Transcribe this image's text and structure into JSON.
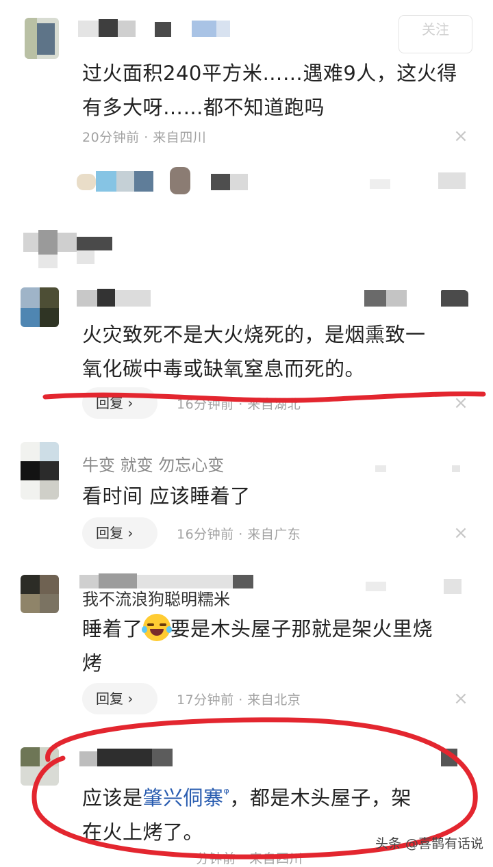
{
  "header": {
    "follow_label": "关注"
  },
  "comments": [
    {
      "text_line1": "过火面积240平方米……遇难9人，这火得",
      "text_line2": "有多大呀……都不知道跑吗",
      "meta": "20分钟前 · 来自四川"
    },
    {
      "partial_header": "回复",
      "text_line1": "火灾致死不是大火烧死的，是烟熏致一",
      "text_line2": "氧化碳中毒或缺氧窒息而死的。",
      "reply_label": "回复 ›",
      "meta": "16分钟前 · 来自湖北"
    },
    {
      "username": "牛变 就变 勿忘心变",
      "text_line1": "看时间 应该睡着了",
      "reply_label": "回复 ›",
      "meta": "16分钟前 · 来自广东"
    },
    {
      "username": "我不流浪狗聪明糯米",
      "text_line1_a": "睡着了",
      "text_line1_b": "要是木头屋子那就是架火里烧",
      "text_line2": "烤",
      "reply_label": "回复 ›",
      "meta": "17分钟前 · 来自北京"
    },
    {
      "text_line1_a": "应该是",
      "mention": "肇兴侗寨",
      "text_line1_b": "，都是木头屋子，架",
      "text_line2": "在火上烤了。",
      "meta": "分钟前 · 来自四川"
    }
  ],
  "icons": {
    "close": "×",
    "search_mark": "ᵠ"
  },
  "watermark": "头条 @喜鹊有话说",
  "colors": {
    "annotation_red": "#e3262f",
    "mention_blue": "#2a5db0"
  }
}
